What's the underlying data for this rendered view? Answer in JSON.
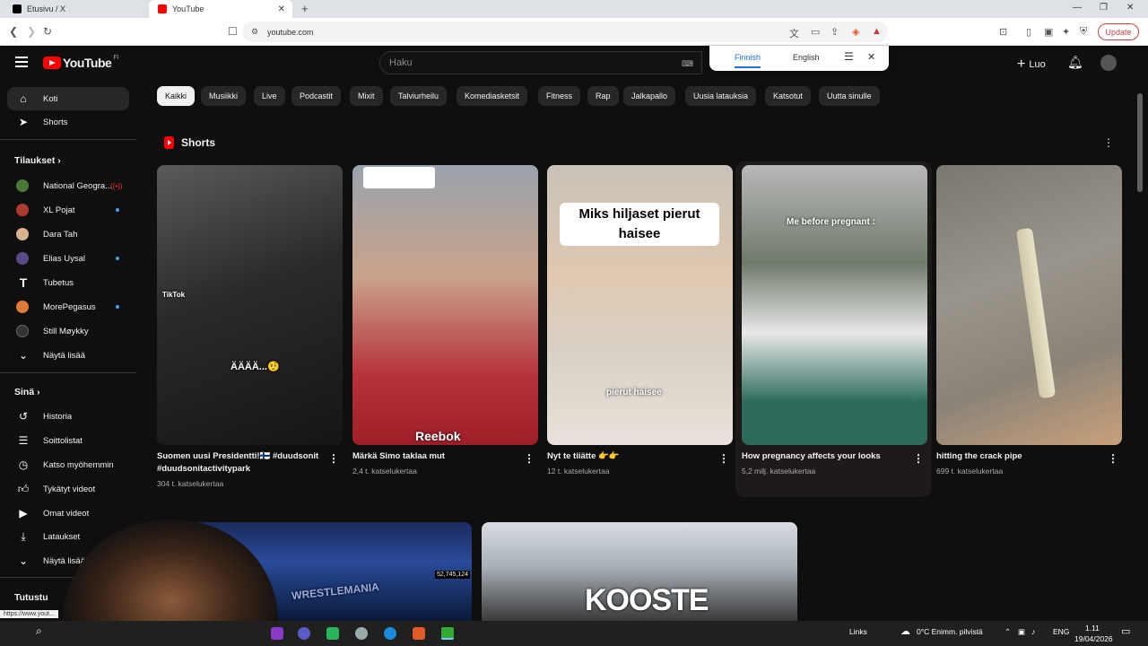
{
  "browser": {
    "tabs": [
      {
        "title": "Etusivu / X",
        "icon": "x-icon"
      },
      {
        "title": "YouTube",
        "icon": "youtube-icon",
        "active": true
      }
    ],
    "url": "youtube.com",
    "update_label": "Update"
  },
  "translate_popup": {
    "options": [
      "Finnish",
      "English"
    ],
    "selected": "Finnish"
  },
  "header": {
    "logo_text": "YouTube",
    "country_code": "FI",
    "search_placeholder": "Haku",
    "create_label": "Luo"
  },
  "sidebar": {
    "main": [
      {
        "label": "Koti",
        "icon": "home-icon",
        "active": true
      },
      {
        "label": "Shorts",
        "icon": "shorts-icon"
      }
    ],
    "subscriptions_heading": "Tilaukset",
    "subscriptions": [
      {
        "label": "National Geogra...",
        "color": "#4a7a3a",
        "badge": "live"
      },
      {
        "label": "XL Pojat",
        "color": "#b03a2e",
        "badge": "dot"
      },
      {
        "label": "Dara Tah",
        "color": "#d9b38c",
        "badge": ""
      },
      {
        "label": "Elias Uysal",
        "color": "#5a4a8a",
        "badge": "dot"
      },
      {
        "label": "Tubetus",
        "color": "#ffffff",
        "badge": ""
      },
      {
        "label": "MorePegasus",
        "color": "#e07a3a",
        "badge": "dot"
      },
      {
        "label": "Still Møykky",
        "color": "#333333",
        "badge": ""
      }
    ],
    "show_more_1": "Näytä lisää",
    "you_heading": "Sinä",
    "you_items": [
      {
        "label": "Historia",
        "icon": "history-icon"
      },
      {
        "label": "Soittolistat",
        "icon": "playlists-icon"
      },
      {
        "label": "Katso myöhemmin",
        "icon": "watch-later-icon"
      },
      {
        "label": "Tykätyt videot",
        "icon": "like-icon"
      },
      {
        "label": "Omat videot",
        "icon": "your-videos-icon"
      },
      {
        "label": "Lataukset",
        "icon": "download-icon"
      }
    ],
    "show_more_2": "Näytä lisää",
    "explore_heading": "Tutustu"
  },
  "chips": [
    "Kaikki",
    "Musiikki",
    "Live",
    "Podcastit",
    "Mixit",
    "Talviurheilu",
    "Komediasketsit",
    "Fitness",
    "Rap",
    "Jalkapallo",
    "Uusia latauksia",
    "Katsotut",
    "Uutta sinulle"
  ],
  "shorts": {
    "title": "Shorts",
    "items": [
      {
        "title": "Suomen uusi Presidentti!🇫🇮 #duudsonit  #duudsonitactivitypark",
        "views": "304 t. katselukertaa",
        "overlay": "ÄÄÄÄ...🤨",
        "watermark": "TikTok"
      },
      {
        "title": "Märkä Simo taklaa mut",
        "views": "2,4 t. katselukertaa",
        "overlay": "Reebok"
      },
      {
        "title": "Nyt te tiiätte 👉👉",
        "views": "12 t. katselukertaa",
        "overlay": "Miks hiljaset pierut haisee",
        "overlay2": "pierut haisee"
      },
      {
        "title": "How pregnancy affects your looks",
        "views": "5,2 milj. katselukertaa",
        "overlay": "Me before pregnant :"
      },
      {
        "title": "hitting the crack pipe",
        "views": "699 t. katselukertaa",
        "overlay": ""
      }
    ]
  },
  "bottom_row": [
    {
      "overlay": "WRESTLEMANIA",
      "badge": "52,745,124"
    },
    {
      "overlay": "KOOSTE"
    }
  ],
  "taskbar": {
    "links": "Links",
    "weather": "0°C  Enimm. pilvistä",
    "lang": "ENG",
    "time": "1.11",
    "date": "19/04/2026",
    "status_url": "https://www.yout..."
  }
}
